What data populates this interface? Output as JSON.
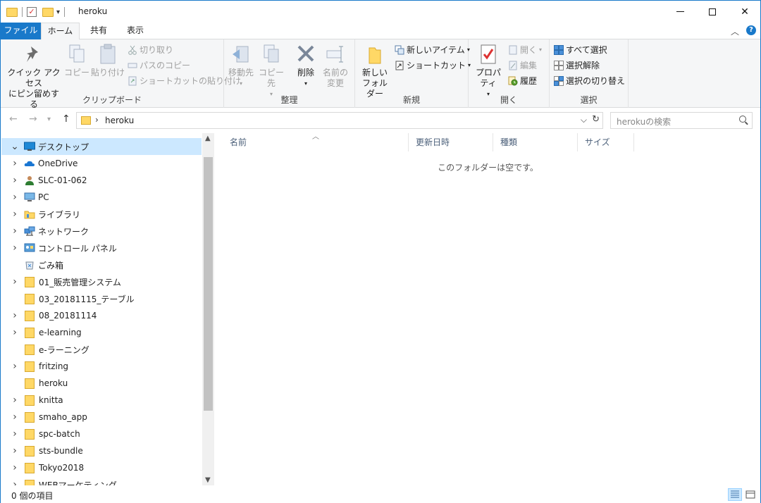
{
  "window": {
    "title": "heroku",
    "qat_dropdown": "▾"
  },
  "tabs": [
    {
      "label": "ファイル"
    },
    {
      "label": "ホーム"
    },
    {
      "label": "共有"
    },
    {
      "label": "表示"
    }
  ],
  "ribbon": {
    "clipboard": {
      "quick_access": "クイック アクセス\nにピン留めする",
      "copy": "コピー",
      "paste": "貼り付け",
      "cut": "切り取り",
      "copy_path": "パスのコピー",
      "paste_shortcut": "ショートカットの貼り付け",
      "label": "クリップボード"
    },
    "organize": {
      "move_to": "移動先",
      "copy_to": "コピー先",
      "delete": "削除",
      "rename": "名前の\n変更",
      "label": "整理"
    },
    "new": {
      "new_folder": "新しい\nフォルダー",
      "new_item": "新しいアイテム",
      "shortcut": "ショートカット",
      "label": "新規"
    },
    "open": {
      "properties": "プロパティ",
      "open": "開く",
      "edit": "編集",
      "history": "履歴",
      "label": "開く"
    },
    "select": {
      "select_all": "すべて選択",
      "select_none": "選択解除",
      "invert": "選択の切り替え",
      "label": "選択"
    }
  },
  "address": {
    "path": "heroku",
    "search_placeholder": "herokuの検索"
  },
  "nav_tree": [
    {
      "label": "デスクトップ",
      "icon": "desktop-icon",
      "expander": "open",
      "selected": true
    },
    {
      "label": "OneDrive",
      "icon": "onedrive-icon",
      "expander": "closed"
    },
    {
      "label": "SLC-01-062",
      "icon": "user-icon",
      "expander": "closed"
    },
    {
      "label": "PC",
      "icon": "pc-icon",
      "expander": "closed"
    },
    {
      "label": "ライブラリ",
      "icon": "library-icon",
      "expander": "closed"
    },
    {
      "label": "ネットワーク",
      "icon": "network-icon",
      "expander": "closed"
    },
    {
      "label": "コントロール パネル",
      "icon": "control-panel-icon",
      "expander": "closed"
    },
    {
      "label": "ごみ箱",
      "icon": "recycle-bin-icon",
      "expander": "none"
    },
    {
      "label": "01_販売管理システム",
      "icon": "folder-icon",
      "expander": "closed"
    },
    {
      "label": "03_20181115_テーブル",
      "icon": "folder-icon",
      "expander": "none"
    },
    {
      "label": "08_20181114",
      "icon": "folder-icon",
      "expander": "closed"
    },
    {
      "label": "e-learning",
      "icon": "folder-icon",
      "expander": "closed"
    },
    {
      "label": "e-ラーニング",
      "icon": "folder-icon",
      "expander": "none"
    },
    {
      "label": "fritzing",
      "icon": "folder-icon",
      "expander": "closed"
    },
    {
      "label": "heroku",
      "icon": "folder-icon",
      "expander": "none"
    },
    {
      "label": "knitta",
      "icon": "folder-icon",
      "expander": "closed"
    },
    {
      "label": "smaho_app",
      "icon": "folder-icon",
      "expander": "closed"
    },
    {
      "label": "spc-batch",
      "icon": "folder-icon",
      "expander": "closed"
    },
    {
      "label": "sts-bundle",
      "icon": "folder-icon",
      "expander": "closed"
    },
    {
      "label": "Tokyo2018",
      "icon": "folder-icon",
      "expander": "closed"
    },
    {
      "label": "WEBマーケティング",
      "icon": "folder-icon",
      "expander": "closed"
    }
  ],
  "columns": [
    {
      "label": "名前"
    },
    {
      "label": "更新日時"
    },
    {
      "label": "種類"
    },
    {
      "label": "サイズ"
    }
  ],
  "empty_message": "このフォルダーは空です。",
  "status": {
    "item_count": "0 個の項目"
  },
  "colors": {
    "accent": "#1979ca",
    "selection": "#cce8ff",
    "folder": "#ffd866"
  }
}
